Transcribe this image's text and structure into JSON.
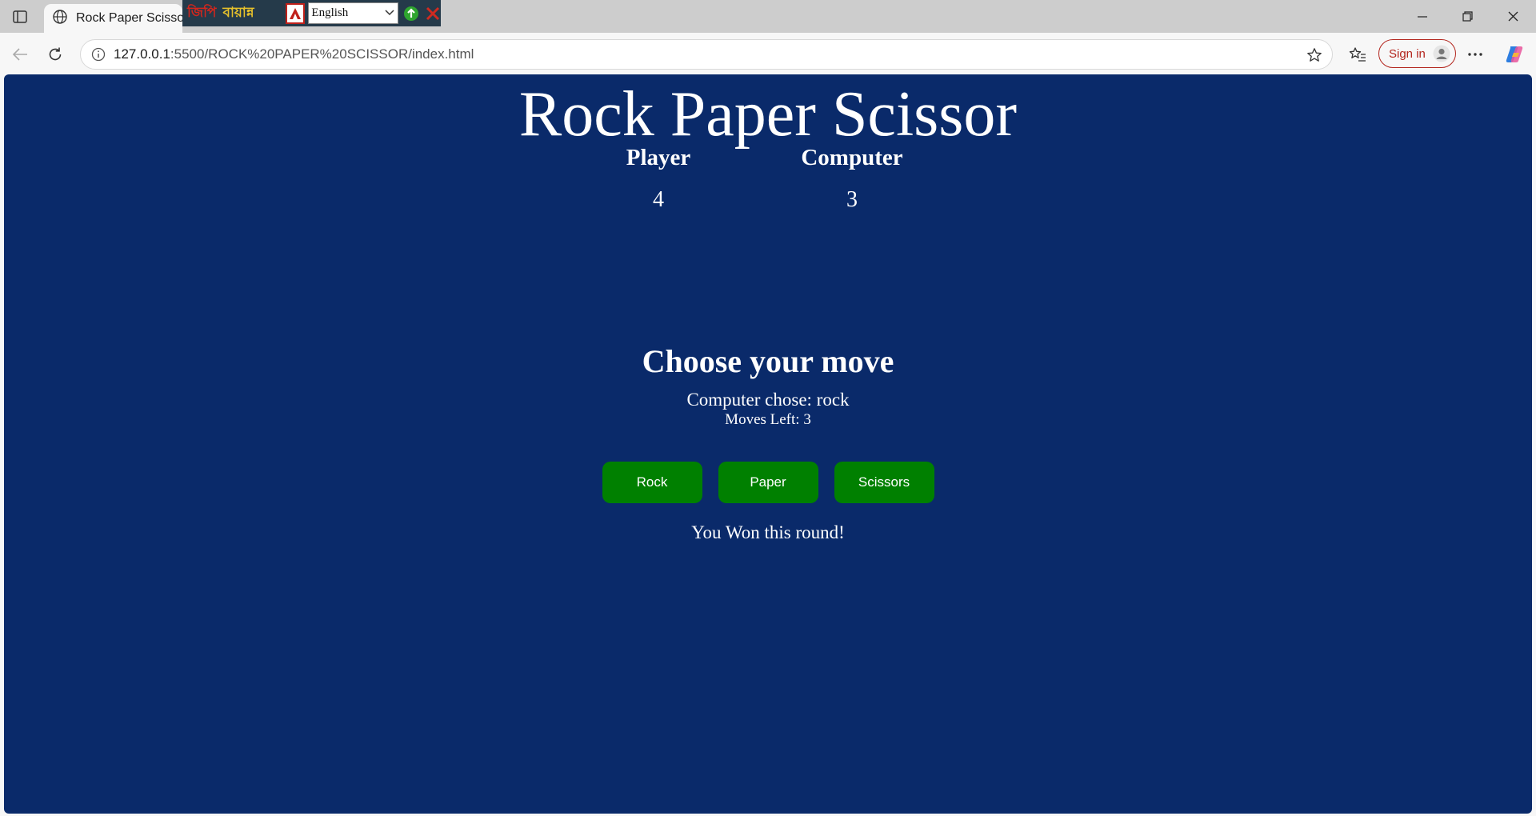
{
  "browser": {
    "tab_title": "Rock Paper Scissor",
    "url_host": "127.0.0.1",
    "url_rest": ":5500/ROCK%20PAPER%20SCISSOR/index.html",
    "signin_label": "Sign in",
    "icons": {
      "sidebar_toggle": "sidebar-icon",
      "tab_favicon": "globe-icon",
      "back": "back-arrow-icon",
      "reload": "reload-icon",
      "site_info": "info-icon",
      "favorite": "star-icon",
      "favorites": "favorites-icon",
      "more": "more-icon",
      "copilot": "copilot-icon"
    },
    "extension": {
      "bangla_text_1": "জিপি",
      "bangla_text_2": "বায়ান্ন",
      "language_selected": "English"
    },
    "colors": {
      "signin_accent": "#b3261e"
    }
  },
  "game": {
    "title": "Rock Paper Scissor",
    "player_label": "Player",
    "player_score": "4",
    "computer_label": "Computer",
    "computer_score": "3",
    "prompt": "Choose your move",
    "computer_choice": "Computer chose: rock",
    "moves_left": "Moves Left: 3",
    "buttons": [
      "Rock",
      "Paper",
      "Scissors"
    ],
    "result": "You Won this round!",
    "colors": {
      "background": "#0a2a6a",
      "button": "#008000",
      "text": "#ffffff"
    }
  }
}
